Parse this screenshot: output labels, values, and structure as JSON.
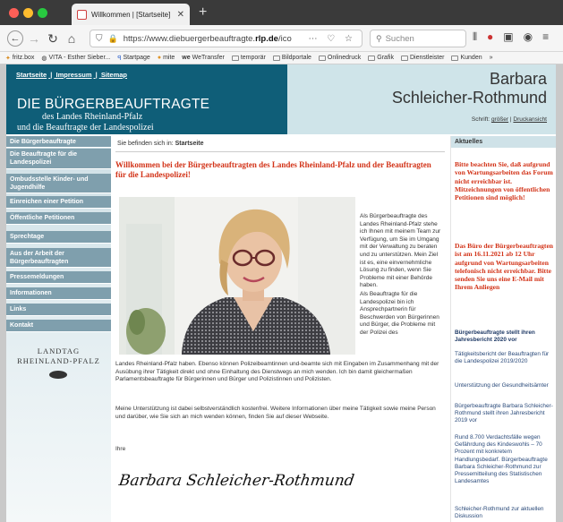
{
  "browser": {
    "tab_title": "Willkommen | [Startseite] | diebuergerb",
    "url_pre": "https://www.diebuergerbeauftragte.",
    "url_domain": "rlp.de",
    "url_post": "/ico",
    "search_placeholder": "Suchen",
    "bookmarks": [
      "fritz.box",
      "VITA - Esther Sieber...",
      "Startpage",
      "mite",
      "WeTransfer",
      "temporär",
      "Bildportale",
      "Onlinedruck",
      "Grafik",
      "Dienstleister",
      "Kunden"
    ],
    "icons": {
      "back": "back-arrow-icon",
      "forward": "forward-arrow-icon",
      "reload": "reload-icon",
      "home": "home-icon"
    }
  },
  "header": {
    "toplinks": [
      "Startseite",
      "|",
      "Impressum",
      "|",
      "Sitemap"
    ],
    "title": "DIE BÜRGERBEAUFTRAGTE",
    "sub1": "des Landes Rheinland-Pfalz",
    "sub2": "und die Beauftragte der Landespolizei",
    "name1": "Barbara",
    "name2": "Schleicher-Rothmund",
    "font_label": "Schrift:",
    "font_larger": "größer",
    "font_sep": "|",
    "font_print": "Druckansicht"
  },
  "nav": {
    "items": [
      "Die Bürgerbeauftragte",
      "Die Beauftragte für die Landespolizei",
      "Ombudsstelle Kinder- und Jugendhilfe",
      "Einreichen einer Petition",
      "Öffentliche Petitionen",
      "Sprechtage",
      "Aus der Arbeit der Bürgerbeauftragten",
      "Pressemeldungen",
      "Informationen",
      "Links",
      "Kontakt"
    ],
    "landtag_line1": "LANDTAG",
    "landtag_line2": "RHEINLAND-PFALZ"
  },
  "main": {
    "breadcrumb_prefix": "Sie befinden sich in:",
    "breadcrumb_current": "Startseite",
    "welcome": "Willkommen bei der Bürgerbeauftragten des Landes Rheinland-Pfalz und der Beauftragten für die Landespolizei!",
    "side_p1": "Als Bürgerbeauftragte des Landes Rheinland-Pfalz stehe ich Ihnen mit meinem Team zur Verfügung, um Sie im Umgang mit der Verwaltung zu beraten und zu unterstützen. Mein Ziel ist es, eine einvernehmliche Lösung zu finden, wenn Sie Probleme mit einer Behörde haben.",
    "side_p2": "Als Beauftragte für die Landespolizei bin ich Ansprechpartnerin für Beschwerden von Bürgerinnen und Bürger, die Probleme mit der Polizei des",
    "body_p1": "Landes Rheinland-Pfalz haben. Ebenso können Polizeibeamtinnen und-beamte sich mit Eingaben im Zusammenhang mit der Ausübung ihrer Tätigkeit direkt und ohne Einhaltung des Dienstwegs an mich wenden. Ich bin damit gleichermaßen Parlamentsbeauftragte für Bürgerinnen und Bürger und Polizistinnen und Polizisten.",
    "body_p2": "Meine Unterstützung ist dabei selbstverständlich kostenfrei. Weitere Informationen über meine Tätigkeit sowie meine Person und darüber, wie Sie sich an mich wenden können, finden Sie auf dieser Webseite.",
    "closing": "Ihre",
    "signature": "Barbara Schleicher-Rothmund"
  },
  "right": {
    "heading": "Aktuelles",
    "notice1": "Bitte beachten Sie, daß aufgrund von Wartungsarbeiten das Forum nicht erreichbar ist. Mitzeichnungen von öffentlichen Petitionen sind möglich!",
    "notice2": "Das Büro der Bürgerbeauftragten ist am 16.11.2021 ab 12 Uhr aufgrund von Wartungsarbeiten telefonisch nicht erreichbar. Bitte senden Sie uns eine E-Mail mit Ihrem Anliegen",
    "links": [
      "Bürgerbeauftragte stellt ihren Jahresbericht 2020 vor",
      "Tätigkeitsbericht der Beauftragten für die Landespolizei 2019/2020",
      "Unterstützung der Gesundheitsämter",
      "Bürgerbeauftragte Barbara Schleicher-Rothmund stellt ihren Jahresbericht 2019 vor",
      "Rund 8.700 Verdachtsfälle wegen Gefährdung des Kindeswohls – 70 Prozent mit konkretem Handlungsbedarf. Bürgerbeauftragte Barbara Schleicher-Rothmund zur Pressemitteilung des Statistischen Landesamtes",
      "Schleicher-Rothmund zur aktuellen Diskussion"
    ]
  },
  "colors": {
    "accent_red": "#d23318",
    "header_teal": "#0f5e78",
    "nav_blue": "#7f9fad"
  }
}
